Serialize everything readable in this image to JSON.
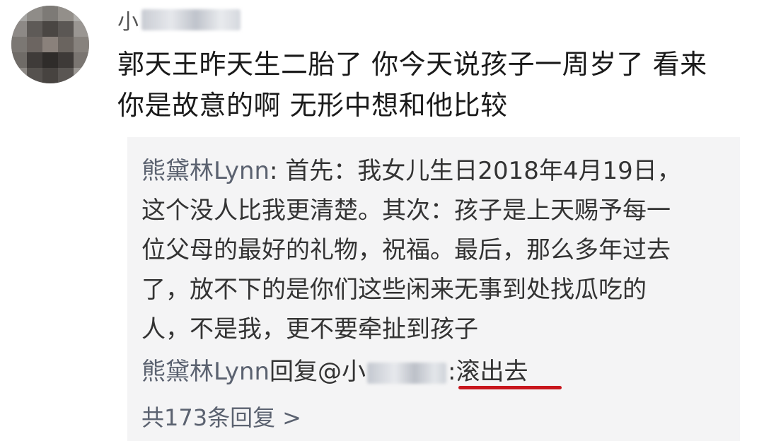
{
  "comment": {
    "username_prefix": "小",
    "text_lines": [
      "郭天王昨天生二胎了 你今天说孩子一周岁了 看来",
      "你是故意的啊 无形中想和他比较"
    ]
  },
  "reply": {
    "author": "熊黛林Lynn",
    "text_lines": [
      ": 首先：我女儿生日2018年4月19日，",
      "这个没人比我更清楚。其次：孩子是上天赐予每一",
      "位父母的最好的礼物，祝福。最后，那么多年过去",
      "了，放不下的是你们这些闲来无事到处找瓜吃的",
      "人，不是我，更不要牵扯到孩子"
    ]
  },
  "reply2": {
    "author": "熊黛林Lynn",
    "action": "回复@小",
    "mention_tail": "",
    "separator": ":",
    "message": "滚出去"
  },
  "more_replies": {
    "label": "共173条回复",
    "chevron": ">"
  },
  "colors": {
    "underline": "#c8161d",
    "panel_bg": "#f4f4f5",
    "author_link": "#5b6270"
  }
}
